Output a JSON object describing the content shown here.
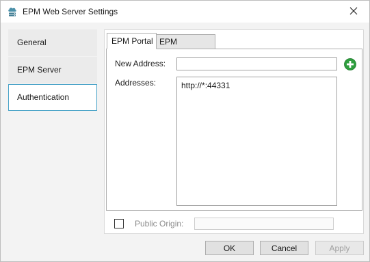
{
  "window": {
    "title": "EPM Web Server Settings",
    "app_icon": "cloud-server-icon",
    "close_icon": "close-icon"
  },
  "nav": {
    "items": [
      {
        "label": "General"
      },
      {
        "label": "EPM Server"
      },
      {
        "label": "Authentication",
        "selected": true
      }
    ]
  },
  "tabs": [
    {
      "label": "EPM Portal",
      "active": true
    },
    {
      "label": "EPM Processor",
      "active": false
    }
  ],
  "form": {
    "new_address_label": "New Address:",
    "new_address_value": "",
    "add_icon": "add-circle-icon",
    "addresses_label": "Addresses:",
    "addresses": [
      "http://*:44331"
    ],
    "public_origin_label": "Public Origin:",
    "public_origin_checked": false,
    "public_origin_value": ""
  },
  "buttons": {
    "ok": "OK",
    "cancel": "Cancel",
    "apply": "Apply"
  },
  "colors": {
    "selection_border": "#4aa3c8",
    "add_green": "#2e9e3e"
  }
}
